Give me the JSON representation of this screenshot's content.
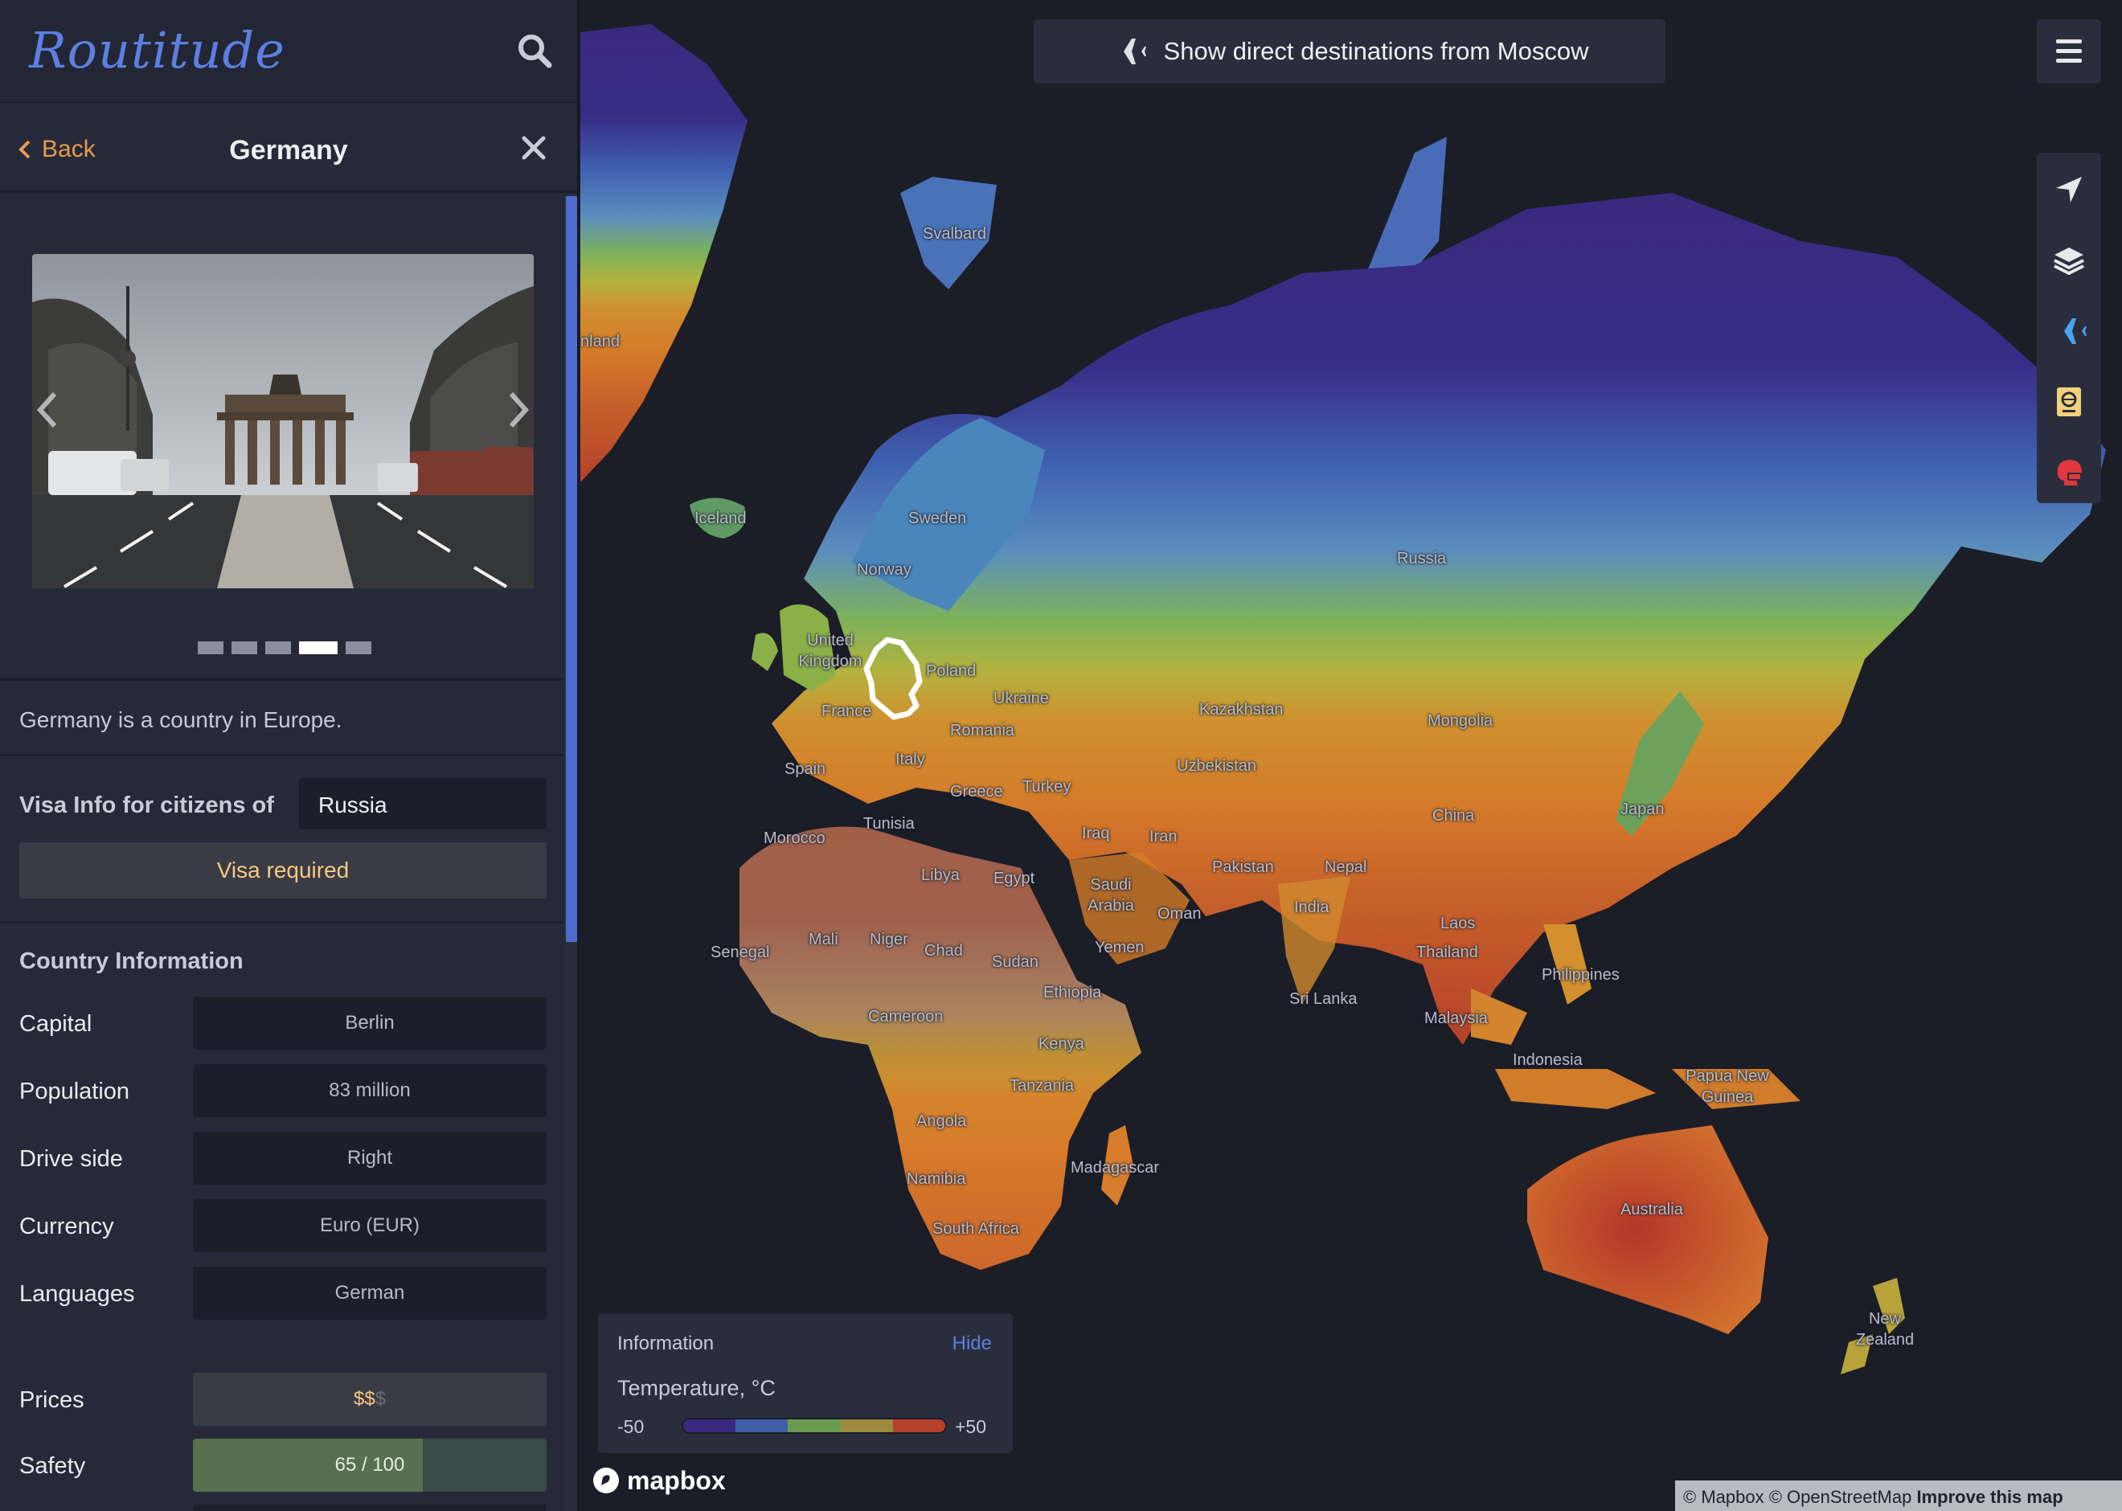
{
  "app": {
    "name": "Routitude"
  },
  "detail": {
    "back_label": "Back",
    "title": "Germany",
    "description": "Germany is a country in Europe."
  },
  "gallery": {
    "count": 5,
    "active_index": 3
  },
  "visa": {
    "label": "Visa Info for citizens of",
    "citizenship": "Russia",
    "status": "Visa required"
  },
  "country_info": {
    "heading": "Country Information",
    "rows": [
      {
        "label": "Capital",
        "value": "Berlin"
      },
      {
        "label": "Population",
        "value": "83 million"
      },
      {
        "label": "Drive side",
        "value": "Right"
      },
      {
        "label": "Currency",
        "value": "Euro (EUR)"
      },
      {
        "label": "Languages",
        "value": "German"
      }
    ],
    "prices": {
      "label": "Prices",
      "value_strong": "$$",
      "value_dim": "$"
    },
    "safety": {
      "label": "Safety",
      "value": "65 / 100",
      "fraction": 0.65
    }
  },
  "map": {
    "direct_button": "Show direct destinations from Moscow",
    "info_panel": {
      "title": "Information",
      "hide_label": "Hide",
      "legend_title": "Temperature, °C",
      "min": "-50",
      "max": "+50",
      "scale_colors": [
        "#3a2a7e",
        "#405fa8",
        "#6b9b4f",
        "#9c8a3d",
        "#b5412b"
      ]
    },
    "labels": [
      "Svalbard",
      "nland",
      "Iceland",
      "Sweden",
      "Norway",
      "Russia",
      "United Kingdom",
      "Poland",
      "Ukraine",
      "France",
      "Romania",
      "Kazakhstan",
      "Mongolia",
      "Spain",
      "Italy",
      "Greece",
      "Turkey",
      "Uzbekistan",
      "Tunisia",
      "Morocco",
      "Iraq",
      "Iran",
      "China",
      "Japan",
      "Libya",
      "Egypt",
      "Saudi Arabia",
      "Pakistan",
      "Nepal",
      "Oman",
      "India",
      "Laos",
      "Mali",
      "Niger",
      "Chad",
      "Sudan",
      "Senegal",
      "Yemen",
      "Thailand",
      "Philippines",
      "Sri Lanka",
      "Ethiopia",
      "Malaysia",
      "Cameroon",
      "Kenya",
      "Indonesia",
      "Papua New Guinea",
      "Tanzania",
      "Angola",
      "Madagascar",
      "Namibia",
      "South Africa",
      "Australia",
      "New Zealand"
    ],
    "attribution": {
      "mapbox": "© Mapbox",
      "osm": "© OpenStreetMap",
      "improve": "Improve this map"
    },
    "logo_text": "mapbox"
  },
  "colors": {
    "accent": "#5c7fe0",
    "back": "#e49a4e",
    "visa_required": "#f3c982",
    "flight_icon": "#4aa3f0",
    "covid_icon": "#e0383d",
    "passport_icon": "#f2d27a"
  }
}
